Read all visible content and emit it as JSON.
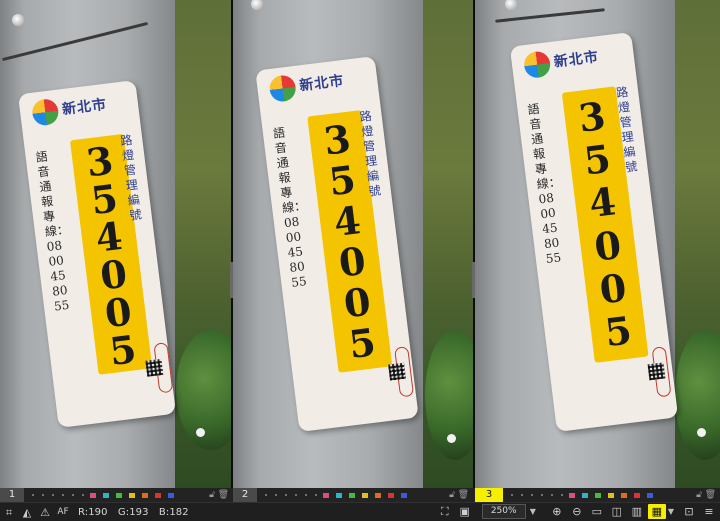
{
  "panes": [
    {
      "number": "1",
      "active": false,
      "sign": {
        "city": "新北市",
        "number_digits": [
          "3",
          "5",
          "4",
          "0",
          "0",
          "5"
        ],
        "left_text": "語音通報專線：0800458055",
        "right_text": "路燈管理編號"
      }
    },
    {
      "number": "2",
      "active": false,
      "sign": {
        "city": "新北市",
        "number_digits": [
          "3",
          "5",
          "4",
          "0",
          "0",
          "5"
        ],
        "left_text": "語音通報專線：0800458055",
        "right_text": "路燈管理編號"
      }
    },
    {
      "number": "3",
      "active": true,
      "sign": {
        "city": "新北市",
        "number_digits": [
          "3",
          "5",
          "4",
          "0",
          "0",
          "5"
        ],
        "left_text": "語音通報專線：0800458055",
        "right_text": "路燈管理編號"
      }
    }
  ],
  "label_colors": [
    "#e04a8a",
    "#2fb3c9",
    "#3fbf3f",
    "#e0c020",
    "#e06a20",
    "#e03030",
    "#3a5ae0"
  ],
  "colors": {
    "active_accent": "#f6f000",
    "sign_yellow": "#f4c400",
    "sign_blue": "#2f3f8f"
  },
  "status": {
    "r_label": "R:190",
    "g_label": "G:193",
    "b_label": "B:182",
    "af_label": "AF",
    "zoom_value": "250%"
  },
  "icons": {
    "grid": "grid-icon",
    "layers": "layers-icon",
    "warning": "warning-icon",
    "af": "autofocus-icon",
    "fit": "fit-screen-icon",
    "actual": "actual-size-icon",
    "zoom_in": "zoom-in-icon",
    "zoom_out": "zoom-out-icon",
    "single": "single-view-icon",
    "dual": "dual-view-icon",
    "triple": "triple-view-icon",
    "sync": "sync-icon",
    "lock": "lock-icon",
    "trash": "trash-icon"
  }
}
